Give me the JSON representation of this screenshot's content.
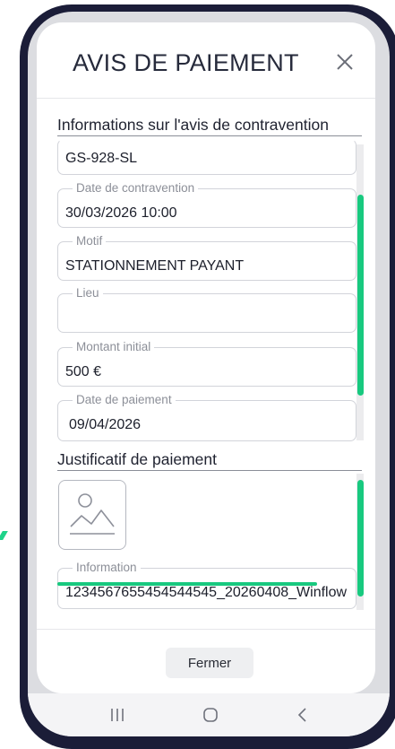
{
  "modal": {
    "title": "AVIS DE PAIEMENT",
    "close_icon": "close-icon",
    "section_infos": "Informations sur l'avis de contravention",
    "fields": {
      "plate_value": "GS-928-SL",
      "date_label": "Date de contravention",
      "date_value": "30/03/2026 10:00",
      "motif_label": "Motif",
      "motif_value": "STATIONNEMENT PAYANT",
      "lieu_label": "Lieu",
      "lieu_value": "",
      "montant_label": "Montant initial",
      "montant_value": "500 €",
      "paiement_label": "Date de paiement",
      "paiement_value": "09/04/2026"
    },
    "section_justif": "Justificatif de paiement",
    "image_icon": "image-placeholder-icon",
    "information_label": "Information",
    "information_value": "1234567655454544545_20260408_Winflow",
    "close_button": "Fermer"
  },
  "navbar": {
    "icons": [
      "recent-apps-icon",
      "home-icon",
      "back-icon"
    ]
  },
  "colors": {
    "accent": "#18c97f",
    "phone_frame": "#1b1d38"
  }
}
